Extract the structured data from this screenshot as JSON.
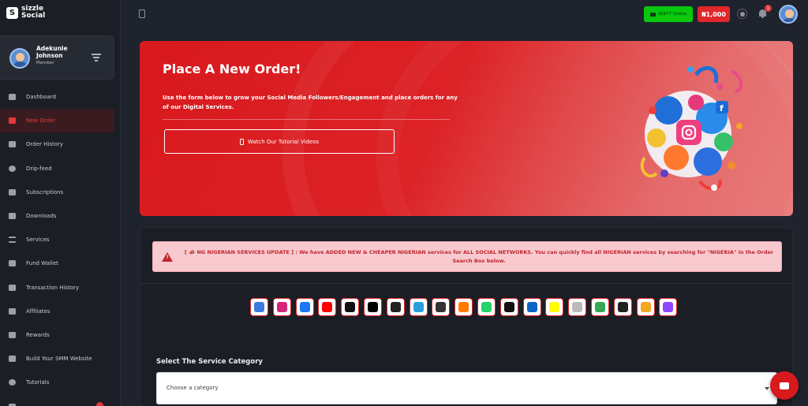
{
  "brand": {
    "name_line1": "sizzle",
    "name_line2": "Social",
    "logo_glyph": "S"
  },
  "user": {
    "name": "Adekunle Johnson",
    "role": "Member"
  },
  "sidebar": {
    "items": [
      {
        "label": "Dashboard",
        "icon": "chart-icon",
        "active": false
      },
      {
        "label": "New Order",
        "icon": "cart-icon",
        "active": true
      },
      {
        "label": "Order History",
        "icon": "calendar-icon",
        "active": false
      },
      {
        "label": "Drip-feed",
        "icon": "clock-icon",
        "active": false
      },
      {
        "label": "Subscriptions",
        "icon": "thumbs-up-icon",
        "active": false
      },
      {
        "label": "Downloads",
        "icon": "download-icon",
        "active": false
      },
      {
        "label": "Services",
        "icon": "list-icon",
        "active": false
      },
      {
        "label": "Fund Wallet",
        "icon": "wallet-icon",
        "active": false
      },
      {
        "label": "Transaction History",
        "icon": "receipt-icon",
        "active": false
      },
      {
        "label": "Affiliates",
        "icon": "affiliates-icon",
        "active": false
      },
      {
        "label": "Rewards",
        "icon": "gift-icon",
        "active": false
      },
      {
        "label": "Build Your SMM Website",
        "icon": "store-icon",
        "active": false
      },
      {
        "label": "Tutorials",
        "icon": "play-icon",
        "active": false
      }
    ]
  },
  "topbar": {
    "online": "16977 Online",
    "balance": "₦1,000",
    "notifications": "1"
  },
  "hero": {
    "title": "Place A New Order!",
    "description": "Use the form below to grow your Social Media Followers/Engagement and place orders for any of our Digital Services.",
    "button": "Watch Our Tutorial Videos"
  },
  "alert": {
    "text": "[ 📣 NG NIGERIAN SERVICES UPDATE ] : We have ADDED NEW & CHEAPER NIGERIAN services for ALL SOCIAL NETWORKS. You can quickly find all NIGERIAN services by searching for \"NIGERIA\" in the Order Search Box below."
  },
  "networks": [
    {
      "icon": "all-services-icon",
      "color": "#3b7be0"
    },
    {
      "icon": "instagram-icon",
      "color": "#d6247a"
    },
    {
      "icon": "facebook-icon",
      "color": "#1877f2"
    },
    {
      "icon": "youtube-icon",
      "color": "#ff0000"
    },
    {
      "icon": "tiktok-icon",
      "color": "#111111"
    },
    {
      "icon": "x-twitter-icon",
      "color": "#000000"
    },
    {
      "icon": "threads-icon",
      "color": "#222222"
    },
    {
      "icon": "telegram-icon",
      "color": "#2aa0da"
    },
    {
      "icon": "snapchat-ghost-icon",
      "color": "#333333"
    },
    {
      "icon": "audiomack-icon",
      "color": "#ff7a00"
    },
    {
      "icon": "whatsapp-icon",
      "color": "#25d366"
    },
    {
      "icon": "apple-icon",
      "color": "#111111"
    },
    {
      "icon": "linkedin-icon",
      "color": "#0a66c2"
    },
    {
      "icon": "snapchat-icon",
      "color": "#fffc00"
    },
    {
      "icon": "boomplay-icon",
      "color": "#bbbbbb"
    },
    {
      "icon": "google-play-icon",
      "color": "#34a853"
    },
    {
      "icon": "settings-icon",
      "color": "#222222"
    },
    {
      "icon": "refresh-icon",
      "color": "#f5a623"
    },
    {
      "icon": "twitch-icon",
      "color": "#9146ff"
    }
  ],
  "form": {
    "category_label": "Select The Service Category",
    "category_value": "Choose a category"
  }
}
